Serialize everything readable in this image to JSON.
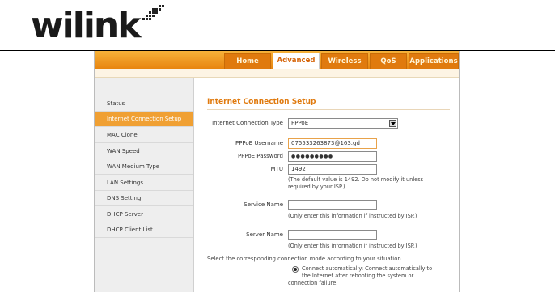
{
  "logo": {
    "text": "wilink"
  },
  "tabs": [
    {
      "label": "Home"
    },
    {
      "label": "Advanced"
    },
    {
      "label": "Wireless"
    },
    {
      "label": "QoS"
    },
    {
      "label": "Applications"
    }
  ],
  "sidebar": {
    "items": [
      {
        "label": "Status"
      },
      {
        "label": "Internet Connection Setup"
      },
      {
        "label": "MAC Clone"
      },
      {
        "label": "WAN Speed"
      },
      {
        "label": "WAN Medium Type"
      },
      {
        "label": "LAN Settings"
      },
      {
        "label": "DNS Setting"
      },
      {
        "label": "DHCP Server"
      },
      {
        "label": "DHCP Client List"
      }
    ]
  },
  "content": {
    "title": "Internet Connection Setup",
    "connection_type": {
      "label": "Internet Connection Type",
      "value": "PPPoE"
    },
    "username": {
      "label": "PPPoE Username",
      "value": "075533263873@163.gd"
    },
    "password": {
      "label": "PPPoE Password",
      "value": "●●●●●●●●●"
    },
    "mtu": {
      "label": "MTU",
      "value": "1492",
      "hint_line1": "(The default value is 1492. Do not modify it unless",
      "hint_line2": "required by your ISP.)"
    },
    "service_name": {
      "label": "Service Name",
      "value": "",
      "hint": "(Only enter this information if instructed by ISP.)"
    },
    "server_name": {
      "label": "Server Name",
      "value": "",
      "hint": "(Only enter this information if instructed by ISP.)"
    },
    "mode_prompt": "Select the corresponding connection mode according to your situation.",
    "mode_option": {
      "line1": "Connect automatically: Connect automatically to",
      "line2": "the Internet after rebooting the system or",
      "line3": "connection failure."
    }
  }
}
